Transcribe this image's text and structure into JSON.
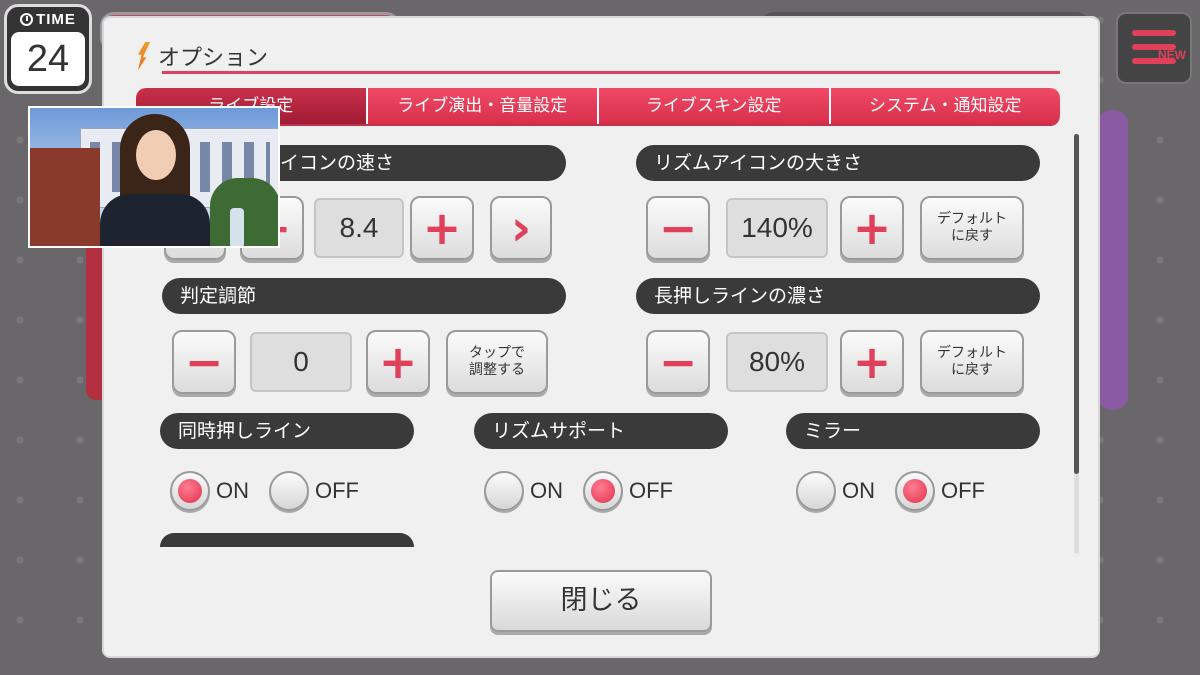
{
  "hud": {
    "timer_label": "TIME",
    "timer_value": "24",
    "new_badge": "NEW"
  },
  "dialog": {
    "title": "オプション",
    "tabs": [
      {
        "label": "ライブ設定",
        "active": true
      },
      {
        "label": "ライブ演出・音量設定",
        "active": false
      },
      {
        "label": "ライブスキン設定",
        "active": false
      },
      {
        "label": "システム・通知設定",
        "active": false
      }
    ],
    "settings": {
      "icon_speed": {
        "label": "リズムアイコンの速さ",
        "visible_label": "イコンの速さ",
        "value": "8.4",
        "plus": "+",
        "minus": "−",
        "next": "›"
      },
      "icon_size": {
        "label": "リズムアイコンの大きさ",
        "value": "140%",
        "plus": "+",
        "minus": "−",
        "default_line1": "デフォルト",
        "default_line2": "に戻す"
      },
      "timing": {
        "label": "判定調節",
        "value": "0",
        "plus": "+",
        "minus": "−",
        "tap_line1": "タップで",
        "tap_line2": "調整する"
      },
      "hold_line": {
        "label": "長押しラインの濃さ",
        "value": "80%",
        "plus": "+",
        "minus": "−",
        "default_line1": "デフォルト",
        "default_line2": "に戻す"
      },
      "sim_line": {
        "label": "同時押しライン",
        "on": "ON",
        "off": "OFF",
        "selected": "ON"
      },
      "rhythm_support": {
        "label": "リズムサポート",
        "on": "ON",
        "off": "OFF",
        "selected": "OFF"
      },
      "mirror": {
        "label": "ミラー",
        "on": "ON",
        "off": "OFF",
        "selected": "OFF"
      }
    },
    "close_label": "閉じる"
  },
  "colors": {
    "accent": "#e0405a",
    "dark_label": "#3a3a3a",
    "dialog_bg": "#f1f0f1"
  }
}
